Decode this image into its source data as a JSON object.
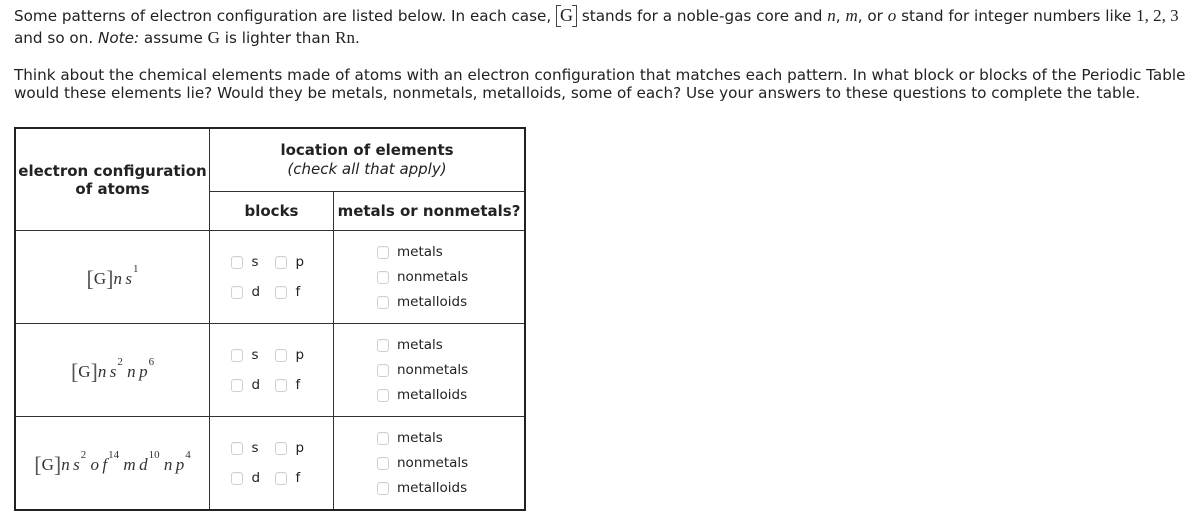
{
  "intro": {
    "p1_part1": "Some patterns of electron configuration are listed below. In each case, ",
    "g_symbol": "G",
    "p1_part2": " stands for a noble-gas core and ",
    "var_n": "n",
    "var_m": "m",
    "or_word": ", or ",
    "var_o": "o",
    "p1_part3": " stand for integer numbers like ",
    "numbers": "1, 2, 3",
    "p1_part4": " and so on. ",
    "note_label": "Note:",
    "note_part1": " assume ",
    "note_g": "G",
    "note_part2": " is lighter than ",
    "note_rn": "Rn",
    "note_end": ".",
    "p2": "Think about the chemical elements made of atoms with an electron configuration that matches each pattern. In what block or blocks of the Periodic Table would these elements lie? Would they be metals, nonmetals, metalloids, some of each? Use your answers to these questions to complete the table."
  },
  "table": {
    "header_config_line1": "electron configuration",
    "header_config_line2": "of atoms",
    "header_location": "location of elements",
    "header_location_sub": "(check all that apply)",
    "header_blocks": "blocks",
    "header_metals": "metals or nonmetals?",
    "block_options": [
      "s",
      "p",
      "d",
      "f"
    ],
    "metal_options": [
      "metals",
      "nonmetals",
      "metalloids"
    ],
    "rows": [
      {
        "core": "G",
        "terms": [
          {
            "n": "n",
            "orb": "s",
            "e": "1"
          }
        ],
        "blocks_checked": [
          false,
          false,
          false,
          false
        ],
        "metals_checked": [
          false,
          false,
          false
        ]
      },
      {
        "core": "G",
        "terms": [
          {
            "n": "n",
            "orb": "s",
            "e": "2"
          },
          {
            "n": "n",
            "orb": "p",
            "e": "6"
          }
        ],
        "blocks_checked": [
          false,
          false,
          false,
          false
        ],
        "metals_checked": [
          false,
          false,
          false
        ]
      },
      {
        "core": "G",
        "terms": [
          {
            "n": "n",
            "orb": "s",
            "e": "2"
          },
          {
            "n": "o",
            "orb": "f",
            "e": "14"
          },
          {
            "n": "m",
            "orb": "d",
            "e": "10"
          },
          {
            "n": "n",
            "orb": "p",
            "e": "4"
          }
        ],
        "blocks_checked": [
          false,
          false,
          false,
          false
        ],
        "metals_checked": [
          false,
          false,
          false
        ]
      }
    ]
  }
}
